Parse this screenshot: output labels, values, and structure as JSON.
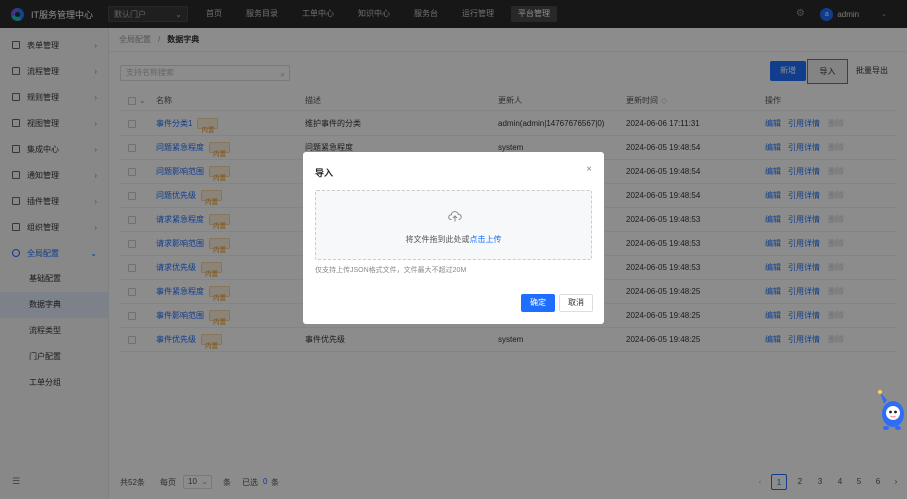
{
  "app": {
    "title": "IT服务管理中心",
    "portal": "默认门户"
  },
  "nav": [
    "首页",
    "服务目录",
    "工单中心",
    "知识中心",
    "服务台",
    "运行管理",
    "平台管理"
  ],
  "user": {
    "avatar": "a",
    "name": "admin"
  },
  "sidebar": {
    "items": [
      "表单管理",
      "流程管理",
      "规则管理",
      "视图管理",
      "集成中心",
      "通知管理",
      "插件管理",
      "组织管理",
      "全局配置"
    ],
    "sub_items": [
      "基础配置",
      "数据字典",
      "流程类型",
      "门户配置",
      "工单分组"
    ]
  },
  "breadcrumb": {
    "parent": "全局配置",
    "current": "数据字典"
  },
  "toolbar": {
    "search_placeholder": "支持名称搜索",
    "new_label": "新增",
    "import_label": "导入",
    "export_label": "批量导出"
  },
  "table": {
    "headers": {
      "name": "名称",
      "desc": "描述",
      "updater": "更新人",
      "time": "更新时间",
      "ops": "操作"
    },
    "rows": [
      {
        "name": "事件分类1",
        "tag": "内置",
        "desc": "维护事件的分类",
        "updater": "admin(admin|14767676567|0)",
        "time": "2024-06-06 17:11:31"
      },
      {
        "name": "问题紧急程度",
        "tag": "内置",
        "desc": "问题紧急程度",
        "updater": "system",
        "time": "2024-06-05 19:48:54"
      },
      {
        "name": "问题影响范围",
        "tag": "内置",
        "desc": "",
        "updater": "",
        "time": "2024-06-05 19:48:54"
      },
      {
        "name": "问题优先级",
        "tag": "内置",
        "desc": "",
        "updater": "",
        "time": "2024-06-05 19:48:54"
      },
      {
        "name": "请求紧急程度",
        "tag": "内置",
        "desc": "",
        "updater": "",
        "time": "2024-06-05 19:48:53"
      },
      {
        "name": "请求影响范围",
        "tag": "内置",
        "desc": "",
        "updater": "",
        "time": "2024-06-05 19:48:53"
      },
      {
        "name": "请求优先级",
        "tag": "内置",
        "desc": "",
        "updater": "",
        "time": "2024-06-05 19:48:53"
      },
      {
        "name": "事件紧急程度",
        "tag": "内置",
        "desc": "",
        "updater": "",
        "time": "2024-06-05 19:48:25"
      },
      {
        "name": "事件影响范围",
        "tag": "内置",
        "desc": "",
        "updater": "",
        "time": "2024-06-05 19:48:25"
      },
      {
        "name": "事件优先级",
        "tag": "内置",
        "desc": "事件优先级",
        "updater": "system",
        "time": "2024-06-05 19:48:25"
      }
    ],
    "ops": {
      "edit": "编辑",
      "ref": "引用详情",
      "delete": "删除"
    }
  },
  "footer": {
    "total_prefix": "共",
    "total": "52",
    "total_suffix": "条",
    "per_page_label": "每页",
    "page_size": "10",
    "per_page_suffix": "条",
    "selected_label": "已选",
    "selected": "0",
    "selected_suffix": "条",
    "pages": [
      "1",
      "2",
      "3",
      "4",
      "5",
      "6"
    ],
    "prev": "‹",
    "next": "›"
  },
  "modal": {
    "title": "导入",
    "close": "×",
    "drop_text": "将文件拖到此处或",
    "drop_link": "点击上传",
    "tip": "仅支持上传JSON格式文件，文件最大不超过20M",
    "ok": "确定",
    "cancel": "取消"
  }
}
